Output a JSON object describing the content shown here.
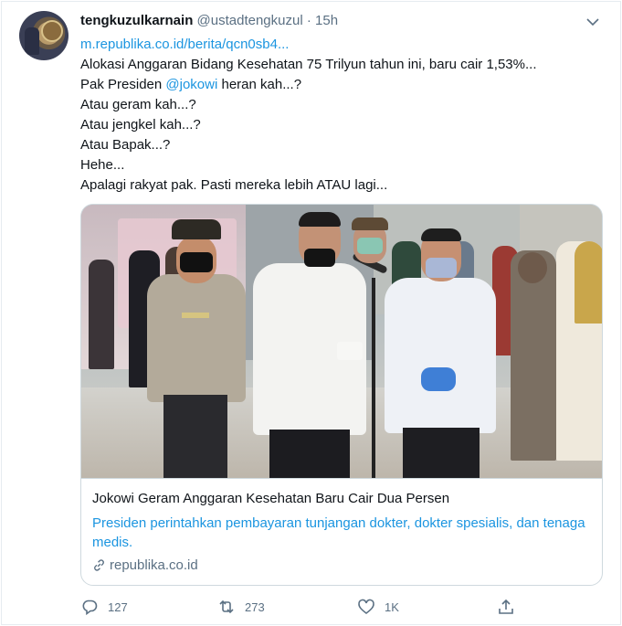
{
  "tweet": {
    "display_name": "tengkuzulkarnain",
    "handle": "@ustadtengkuzul",
    "separator": "·",
    "time": "15h",
    "link_text": "m.republika.co.id/berita/qcn0sb4...",
    "lines": {
      "l1": "Alokasi Anggaran Bidang Kesehatan 75 Trilyun tahun ini, baru cair 1,53%...",
      "l2_pre": "Pak Presiden ",
      "l2_mention": "@jokowi",
      "l2_post": " heran kah...?",
      "l3": "Atau geram kah...?",
      "l4": "Atau jengkel kah...?",
      "l5": "Atau Bapak...?",
      "l6": "Hehe...",
      "l7": "Apalagi rakyat pak. Pasti mereka lebih ATAU lagi..."
    }
  },
  "card": {
    "title": "Jokowi Geram Anggaran Kesehatan Baru Cair Dua Persen",
    "description": "Presiden perintahkan pembayaran tunjangan dokter, dokter spesialis, dan tenaga medis.",
    "domain": "republika.co.id"
  },
  "actions": {
    "reply_count": "127",
    "retweet_count": "273",
    "like_count": "1K"
  },
  "colors": {
    "link": "#1b95e0",
    "muted": "#5b7083",
    "border": "#cfd9de"
  },
  "icons": [
    "avatar",
    "chevron-down-icon",
    "link-icon",
    "reply-icon",
    "retweet-icon",
    "like-icon",
    "share-icon"
  ]
}
